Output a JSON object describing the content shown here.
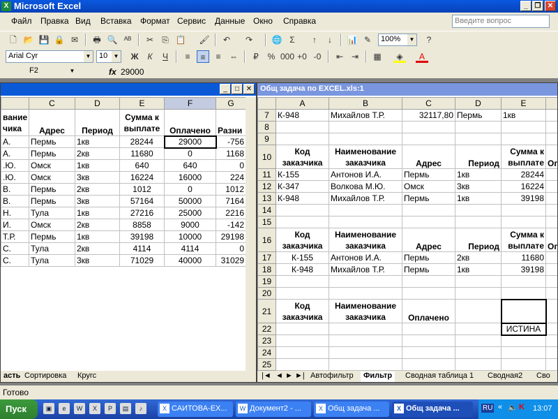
{
  "app": {
    "title": "Microsoft Excel"
  },
  "menu": [
    "Файл",
    "Правка",
    "Вид",
    "Вставка",
    "Формат",
    "Сервис",
    "Данные",
    "Окно",
    "Справка"
  ],
  "help_placeholder": "Введите вопрос",
  "toolbar": {
    "zoom": "100%"
  },
  "format": {
    "font": "Arial Cyr",
    "size": "10"
  },
  "formula": {
    "cell": "F2",
    "fx": "fx",
    "value": "29000"
  },
  "left_window": {
    "col_headers": [
      "C",
      "D",
      "E",
      "F",
      "G"
    ],
    "header_row": [
      "вание\nчика",
      "Адрес",
      "Период",
      "Сумма к выплате",
      "Оплачено",
      "Разни"
    ],
    "rows": [
      [
        "А.",
        "Пермь",
        "1кв",
        "28244",
        "29000",
        "-756"
      ],
      [
        "А.",
        "Пермь",
        "2кв",
        "11680",
        "0",
        "1168"
      ],
      [
        ".Ю.",
        "Омск",
        "1кв",
        "640",
        "640",
        "0"
      ],
      [
        ".Ю.",
        "Омск",
        "3кв",
        "16224",
        "16000",
        "224"
      ],
      [
        "В.",
        "Пермь",
        "2кв",
        "1012",
        "0",
        "1012"
      ],
      [
        "В.",
        "Пермь",
        "3кв",
        "57164",
        "50000",
        "7164"
      ],
      [
        "Н.",
        "Тула",
        "1кв",
        "27216",
        "25000",
        "2216"
      ],
      [
        "И.",
        "Омск",
        "2кв",
        "8858",
        "9000",
        "-142"
      ],
      [
        "Т.Р.",
        "Пермь",
        "1кв",
        "39198",
        "10000",
        "29198"
      ],
      [
        "С.",
        "Тула",
        "2кв",
        "4114",
        "4114",
        "0"
      ],
      [
        "С.",
        "Тула",
        "3кв",
        "71029",
        "40000",
        "31029"
      ]
    ],
    "tabs": [
      "асть",
      "Сортировка",
      "Кругс"
    ]
  },
  "right_window": {
    "title": "Общ задача по EXCEL.xls:1",
    "col_headers": [
      "A",
      "B",
      "C",
      "D",
      "E"
    ],
    "row_numbers": [
      "7",
      "8",
      "9",
      "10",
      "11",
      "12",
      "13",
      "14",
      "15",
      "16",
      "17",
      "18",
      "19",
      "20",
      "21",
      "22",
      "23",
      "24",
      "25"
    ],
    "row7": [
      "К-948",
      "Михайлов Т.Р.",
      "32117,80",
      "Пермь",
      "1кв"
    ],
    "hdr": {
      "code": "Код заказчика",
      "name": "Наименование заказчика",
      "addr": "Адрес",
      "period": "Период",
      "sum": "Сумма к выплате",
      "paid": "Оплачено",
      "extra": "Оп"
    },
    "block1": [
      [
        "К-155",
        "Антонов И.А.",
        "Пермь",
        "1кв",
        "28244"
      ],
      [
        "К-347",
        "Волкова М.Ю.",
        "Омск",
        "3кв",
        "16224"
      ],
      [
        "К-948",
        "Михайлов Т.Р.",
        "Пермь",
        "1кв",
        "39198"
      ]
    ],
    "block2": [
      [
        "К-155",
        "Антонов И.А.",
        "Пермь",
        "2кв",
        "11680"
      ],
      [
        "К-948",
        "Михайлов Т.Р.",
        "Пермь",
        "1кв",
        "39198"
      ]
    ],
    "istina": "ИСТИНА",
    "tabs": [
      "Автофильтр",
      "Фильтр",
      "Сводная таблица 1",
      "Сводная2",
      "Сво"
    ]
  },
  "status": "Готово",
  "taskbar": {
    "start": "Пуск",
    "tasks": [
      "САИТОВА-EX...",
      "Документ2 - ...",
      "Общ задача ...",
      "Общ задача ..."
    ],
    "lang": "RU",
    "clock": "13:07"
  }
}
